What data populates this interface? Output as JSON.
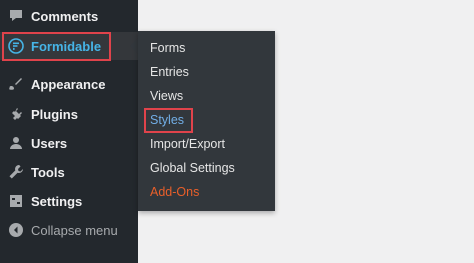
{
  "sidebar": {
    "items": [
      {
        "label": "Comments",
        "icon": "comment-icon"
      },
      {
        "label": "Formidable",
        "icon": "formidable-icon"
      },
      {
        "label": "Appearance",
        "icon": "paintbrush-icon"
      },
      {
        "label": "Plugins",
        "icon": "plugin-icon"
      },
      {
        "label": "Users",
        "icon": "user-icon"
      },
      {
        "label": "Tools",
        "icon": "wrench-icon"
      },
      {
        "label": "Settings",
        "icon": "settings-icon"
      }
    ],
    "collapse_label": "Collapse menu"
  },
  "flyout": {
    "items": [
      {
        "label": "Forms"
      },
      {
        "label": "Entries"
      },
      {
        "label": "Views"
      },
      {
        "label": "Styles"
      },
      {
        "label": "Import/Export"
      },
      {
        "label": "Global Settings"
      },
      {
        "label": "Add-Ons"
      }
    ]
  },
  "colors": {
    "sidebar_bg": "#23282d",
    "flyout_bg": "#32373c",
    "accent": "#72aee6",
    "current_label": "#46b4e6",
    "addons": "#e95f2a",
    "highlight": "#e0434b"
  }
}
